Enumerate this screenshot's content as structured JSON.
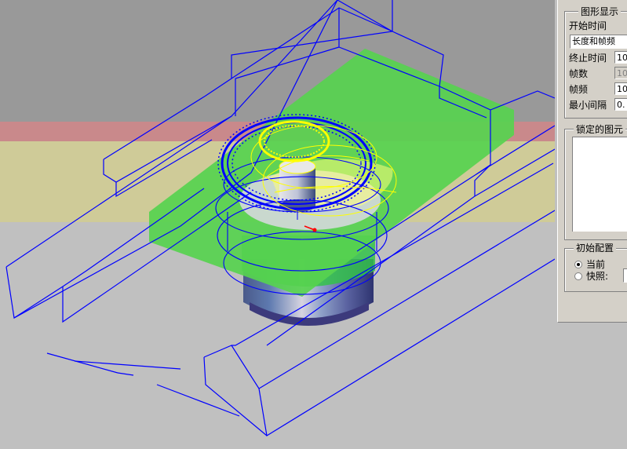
{
  "panel": {
    "display_group": {
      "title": "图形显示",
      "start_time_label": "开始时间",
      "start_time_value": "长度和帧频",
      "end_time_label": "终止时间",
      "end_time_value": "10",
      "frame_count_label": "帧数",
      "frame_count_value": "10",
      "frame_rate_label": "帧频",
      "frame_rate_value": "10",
      "min_interval_label": "最小间隔",
      "min_interval_value": "0."
    },
    "locked_group": {
      "title": "锁定的图元"
    },
    "initial_group": {
      "title": "初始配置",
      "option_current": "当前",
      "option_snapshot": "快照:",
      "selected": "当前"
    }
  },
  "viewport": {
    "colors": {
      "background_top": "#999999",
      "pink_band": "#c9898b",
      "yellow_band": "#cfcb98",
      "floor": "#c0c0c0",
      "wireframe": "#0000ff",
      "plate": "#57d34f",
      "highlight": "#ffff00"
    }
  }
}
